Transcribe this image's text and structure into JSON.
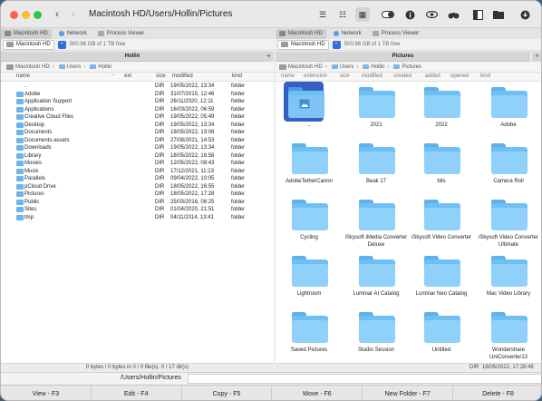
{
  "window": {
    "title": "Macintosh HD/Users/Hollin/Pictures",
    "traffic_colors": [
      "#ff5f57",
      "#febc2e",
      "#28c840"
    ]
  },
  "toolbar_icons": [
    "list-view-icon",
    "columns-view-icon",
    "grid-view-icon",
    "toggle-icon",
    "info-icon",
    "eye-icon",
    "binoculars-icon",
    "dual-pane-icon",
    "folder-icon",
    "download-icon"
  ],
  "tabs": {
    "left": [
      {
        "label": "Macintosh HD",
        "icon": "drive-icon"
      },
      {
        "label": "Network",
        "icon": "network-icon"
      },
      {
        "label": "Process Viewer",
        "icon": "process-icon"
      }
    ],
    "right": [
      {
        "label": "Macintosh HD",
        "icon": "drive-icon"
      },
      {
        "label": "Network",
        "icon": "network-icon"
      },
      {
        "label": "Process Viewer",
        "icon": "process-icon"
      }
    ]
  },
  "left": {
    "volume": "Macintosh HD",
    "free": "500.96 GB of 1 TB free",
    "header": "Hollin",
    "breadcrumb": [
      "Macintosh HD",
      "Users",
      "Hollin"
    ],
    "columns": {
      "name": "name",
      "ext": "ext",
      "size": "size",
      "modified": "modified",
      "kind": "kind"
    },
    "rows": [
      {
        "name": "..",
        "size": "DIR",
        "modified": "19/05/2022, 13:34",
        "kind": "folder"
      },
      {
        "name": "Adobe",
        "size": "DIR",
        "modified": "31/07/2015, 12:46",
        "kind": "folder"
      },
      {
        "name": "Application Support",
        "size": "DIR",
        "modified": "26/11/2020, 12:11",
        "kind": "folder"
      },
      {
        "name": "Applications",
        "size": "DIR",
        "modified": "16/03/2022, 06:59",
        "kind": "folder"
      },
      {
        "name": "Creative Cloud Files",
        "size": "DIR",
        "modified": "19/05/2022, 05:49",
        "kind": "folder"
      },
      {
        "name": "Desktop",
        "size": "DIR",
        "modified": "19/05/2022, 13:34",
        "kind": "folder"
      },
      {
        "name": "Documents",
        "size": "DIR",
        "modified": "18/05/2022, 13:08",
        "kind": "folder"
      },
      {
        "name": "Documents-assets",
        "size": "DIR",
        "modified": "27/08/2021, 14:53",
        "kind": "folder"
      },
      {
        "name": "Downloads",
        "size": "DIR",
        "modified": "19/05/2022, 13:34",
        "kind": "folder"
      },
      {
        "name": "Library",
        "size": "DIR",
        "modified": "18/05/2022, 16:58",
        "kind": "folder"
      },
      {
        "name": "Movies",
        "size": "DIR",
        "modified": "12/05/2022, 08:43",
        "kind": "folder"
      },
      {
        "name": "Music",
        "size": "DIR",
        "modified": "17/12/2021, 11:23",
        "kind": "folder"
      },
      {
        "name": "Parallels",
        "size": "DIR",
        "modified": "09/04/2022, 10:05",
        "kind": "folder"
      },
      {
        "name": "pCloud Drive",
        "size": "DIR",
        "modified": "18/05/2022, 16:55",
        "kind": "folder"
      },
      {
        "name": "Pictures",
        "size": "DIR",
        "modified": "18/05/2022, 17:28",
        "kind": "folder"
      },
      {
        "name": "Public",
        "size": "DIR",
        "modified": "25/03/2016, 08:25",
        "kind": "folder"
      },
      {
        "name": "Sites",
        "size": "DIR",
        "modified": "01/04/2020, 21:51",
        "kind": "folder"
      },
      {
        "name": "tmp",
        "size": "DIR",
        "modified": "04/11/2014, 13:41",
        "kind": "folder"
      }
    ],
    "status": "0 bytes / 0 bytes in 0 / 0 file(s). 0 / 17 dir(s)"
  },
  "right": {
    "volume": "Macintosh HD",
    "free": "500.96 GB of 1 TB free",
    "header": "Pictures",
    "breadcrumb": [
      "Macintosh HD",
      "Users",
      "Hollin",
      "Pictures"
    ],
    "columns": [
      "name",
      "extension",
      "size",
      "modified",
      "created",
      "added",
      "opened",
      "kind"
    ],
    "items": [
      "..",
      "2021",
      "2022",
      "Adobe",
      "AdobeTetherCanon",
      "Beak 17",
      "bits",
      "Camera Roll",
      "Cycling",
      "iSkysoft iMedia Converter Deluxe",
      "iSkysoft Video Converter",
      "iSkysoft Video Converter Ultimate",
      "Lightroom",
      "Luminar AI Catalog",
      "Luminar Neo Catalog",
      "Mac Video Library",
      "Saved Pictures",
      "Studio Session",
      "Untitled",
      "Wondershare UniConverter13"
    ],
    "status_left": "DIR",
    "status_right": "18/05/2022, 17:28:48"
  },
  "pathbar": {
    "path": "/Users/Hollin/Pictures"
  },
  "fkeys": [
    "View - F3",
    "Edit - F4",
    "Copy - F5",
    "Move - F6",
    "New Folder - F7",
    "Delete - F8"
  ],
  "colors": {
    "folder": "#6ec0f2",
    "selection": "#3460c4",
    "accent": "#2f6fe0"
  }
}
